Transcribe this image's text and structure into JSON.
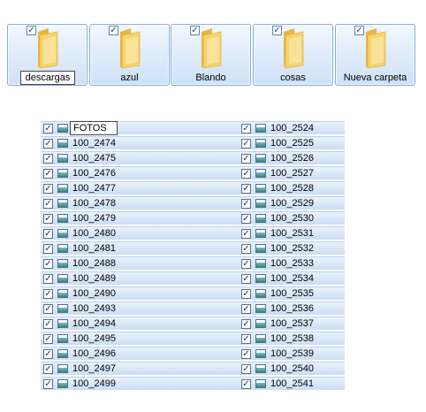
{
  "folders": [
    {
      "label": "descargas",
      "editing": true
    },
    {
      "label": "azul",
      "editing": false
    },
    {
      "label": "Blando",
      "editing": false
    },
    {
      "label": "cosas",
      "editing": false
    },
    {
      "label": "Nueva carpeta",
      "editing": false
    }
  ],
  "check_mark": "✓",
  "left_column": [
    "FOTOS",
    "100_2474",
    "100_2475",
    "100_2476",
    "100_2477",
    "100_2478",
    "100_2479",
    "100_2480",
    "100_2481",
    "100_2488",
    "100_2489",
    "100_2490",
    "100_2493",
    "100_2494",
    "100_2495",
    "100_2496",
    "100_2497",
    "100_2499"
  ],
  "right_column": [
    "100_2524",
    "100_2525",
    "100_2526",
    "100_2527",
    "100_2528",
    "100_2529",
    "100_2530",
    "100_2531",
    "100_2532",
    "100_2533",
    "100_2534",
    "100_2535",
    "100_2536",
    "100_2537",
    "100_2538",
    "100_2539",
    "100_2540",
    "100_2541"
  ],
  "colors": {
    "selection_bg": "#dbe8f9",
    "selection_border": "#84acdd",
    "folder_yellow": "#f2cf62"
  }
}
